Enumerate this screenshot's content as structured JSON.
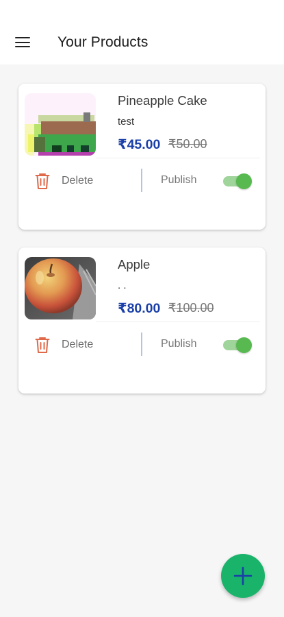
{
  "app_bar": {
    "title": "Your Products",
    "menu_icon": "hamburger-menu-icon"
  },
  "products": [
    {
      "name": "Pineapple Cake",
      "description": "test",
      "price": "₹45.00",
      "mrp": "₹50.00",
      "delete_label": "Delete",
      "publish_label": "Publish",
      "published": true,
      "image_icon": "pixelated-cake-image"
    },
    {
      "name": "Apple",
      "description": ". .",
      "price": "₹80.00",
      "mrp": "₹100.00",
      "delete_label": "Delete",
      "publish_label": "Publish",
      "published": true,
      "image_icon": "apple-photo"
    }
  ],
  "fab": {
    "icon": "plus-icon"
  },
  "colors": {
    "price": "#1a3fa8",
    "delete_icon": "#e0694a",
    "toggle_on": "#57b94f",
    "fab": "#19b36a",
    "fab_icon": "#1a3fa8"
  }
}
